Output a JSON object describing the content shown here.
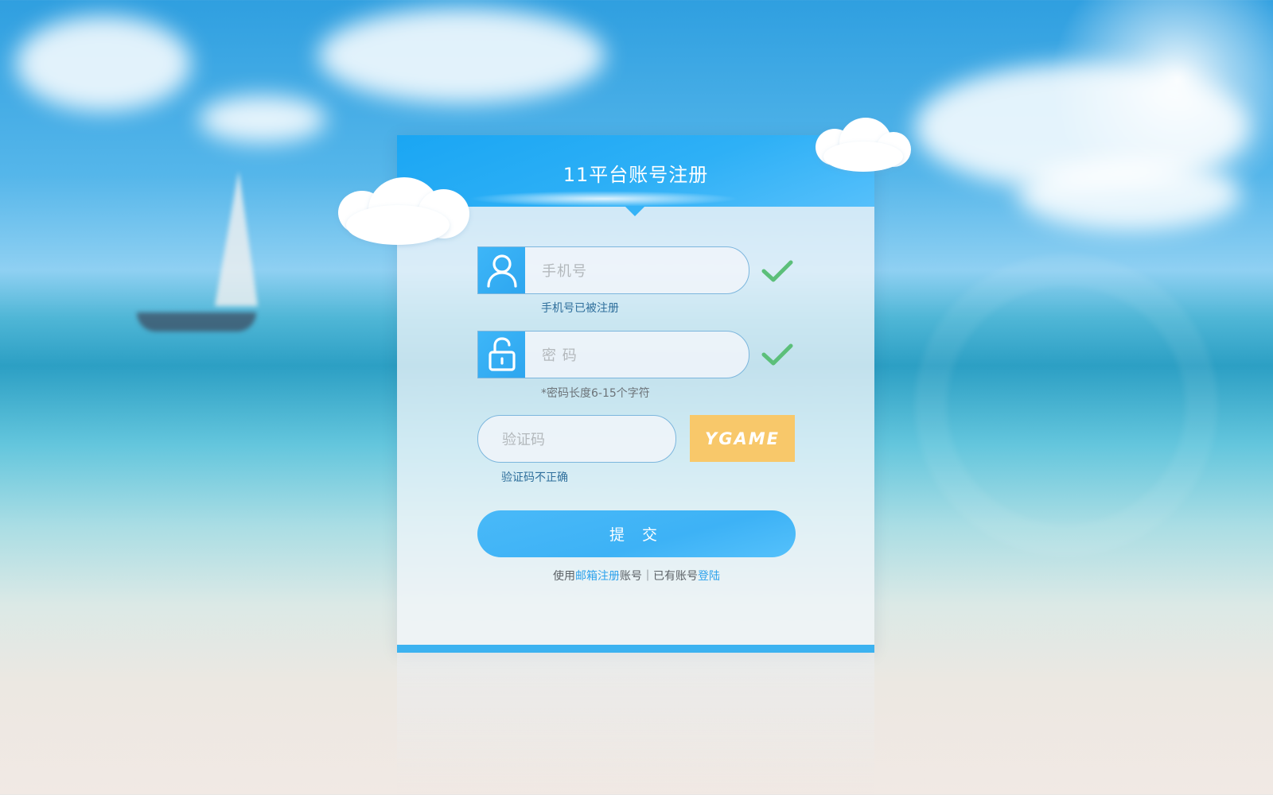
{
  "page": {
    "title": "11平台账号注册"
  },
  "form": {
    "phone": {
      "placeholder": "手机号",
      "status": "valid",
      "hint": "手机号已被注册",
      "icon": "user-icon"
    },
    "password": {
      "placeholder": "密 码",
      "status": "valid",
      "hint": "*密码长度6-15个字符",
      "icon": "unlock-icon"
    },
    "captcha": {
      "placeholder": "验证码",
      "image_text": "YGAME",
      "hint": "验证码不正确"
    },
    "submit_label": "提 交"
  },
  "footer": {
    "prefix": "使用",
    "email_register": "邮箱注册",
    "middle": "账号｜已有账号",
    "login": "登陆"
  },
  "colors": {
    "primary": "#2eaaf4",
    "captcha_bg": "#f8c86a",
    "check": "#5cbf7a",
    "hint_blue": "#2f6f9c",
    "link": "#2ea2ec"
  }
}
